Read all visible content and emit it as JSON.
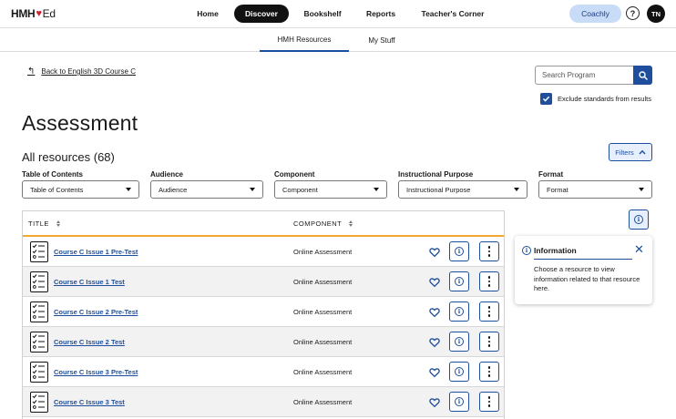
{
  "header": {
    "logo_text": "HMH",
    "logo_suffix": "Ed",
    "nav": [
      {
        "label": "Home",
        "active": false
      },
      {
        "label": "Discover",
        "active": true
      },
      {
        "label": "Bookshelf",
        "active": false
      },
      {
        "label": "Reports",
        "active": false
      },
      {
        "label": "Teacher's Corner",
        "active": false
      }
    ],
    "coachly_label": "Coachly",
    "help_label": "?",
    "avatar_initials": "TN"
  },
  "subnav": {
    "tabs": [
      {
        "label": "HMH Resources",
        "active": true
      },
      {
        "label": "My Stuff",
        "active": false
      }
    ]
  },
  "back_link": "Back to English 3D Course C",
  "search": {
    "placeholder": "Search Program",
    "exclude_label": "Exclude standards from results",
    "exclude_checked": true
  },
  "page_title": "Assessment",
  "results_label": "All resources (68)",
  "filters_button": "Filters",
  "filters": [
    {
      "label": "Table of Contents",
      "value": "Table of Contents"
    },
    {
      "label": "Audience",
      "value": "Audience"
    },
    {
      "label": "Component",
      "value": "Component"
    },
    {
      "label": "Instructional Purpose",
      "value": "Instructional Purpose"
    },
    {
      "label": "Format",
      "value": "Format"
    }
  ],
  "table": {
    "columns": [
      "TITLE",
      "COMPONENT"
    ],
    "rows": [
      {
        "title": "Course C Issue 1 Pre-Test",
        "component": "Online Assessment"
      },
      {
        "title": "Course C Issue 1 Test",
        "component": "Online Assessment"
      },
      {
        "title": "Course C Issue 2 Pre-Test",
        "component": "Online Assessment"
      },
      {
        "title": "Course C Issue 2 Test",
        "component": "Online Assessment"
      },
      {
        "title": "Course C Issue 3 Pre-Test",
        "component": "Online Assessment"
      },
      {
        "title": "Course C Issue 3 Test",
        "component": "Online Assessment"
      }
    ]
  },
  "info_panel": {
    "title": "Information",
    "body": "Choose a resource to view information related to that resource here."
  },
  "colors": {
    "primary": "#1f4f9c",
    "accent_underline": "#f0a830",
    "logo_heart": "#d0202f",
    "coachly_bg": "#c8dcf7"
  },
  "icons": {
    "back": "arrow-return-icon",
    "search": "search-icon",
    "filters_chevron": "chevron-up-icon",
    "row_doc": "checklist-document-icon",
    "favorite": "heart-icon",
    "info": "info-icon",
    "more": "kebab-menu-icon",
    "close": "close-icon"
  }
}
